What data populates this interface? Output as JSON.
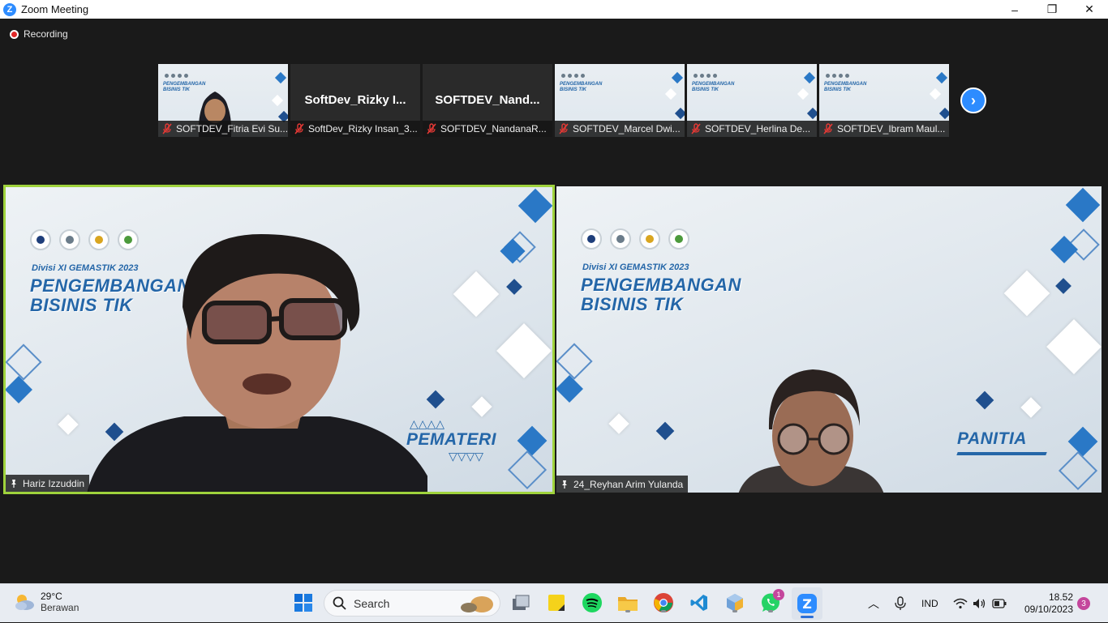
{
  "window": {
    "title": "Zoom Meeting",
    "app_icon": "zoom-icon",
    "minimize": "–",
    "restore": "❐",
    "close": "✕"
  },
  "recording": {
    "label": "Recording"
  },
  "thumbnails": [
    {
      "name": "SOFTDEV_Fitria Evi Su...",
      "has_video": true
    },
    {
      "name": "SoftDev_Rizky Insan_3...",
      "display": "SoftDev_Rizky  I...",
      "has_video": false
    },
    {
      "name": "SOFTDEV_NandanaR...",
      "display": "SOFTDEV_Nand...",
      "has_video": false
    },
    {
      "name": "SOFTDEV_Marcel Dwi...",
      "has_video": true
    },
    {
      "name": "SOFTDEV_Herlina De...",
      "has_video": true
    },
    {
      "name": "SOFTDEV_Ibram Maul...",
      "has_video": true
    }
  ],
  "next_page": "›",
  "main_tiles": {
    "left": {
      "name": "Hariz Izzuddin",
      "divisi": "Divisi XI GEMASTIK 2023",
      "headline_1": "PENGEMBANGAN",
      "headline_2": "BISINIS TIK",
      "role": "PEMATERI",
      "active_speaker": true
    },
    "right": {
      "name": "24_Reyhan Arim Yulanda",
      "divisi": "Divisi XI GEMASTIK 2023",
      "headline_1": "PENGEMBANGAN",
      "headline_2": "BISINIS TIK",
      "role": "PANITIA"
    }
  },
  "taskbar": {
    "weather": {
      "temp": "29°C",
      "condition": "Berawan"
    },
    "search_label": "Search",
    "whatsapp_badge": "1",
    "language": "IND",
    "time": "18.52",
    "date": "09/10/2023",
    "notifications": "3"
  },
  "colors": {
    "accent": "#2d8cff",
    "active_border": "#9fd33c",
    "brand_blue": "#2466a8"
  }
}
